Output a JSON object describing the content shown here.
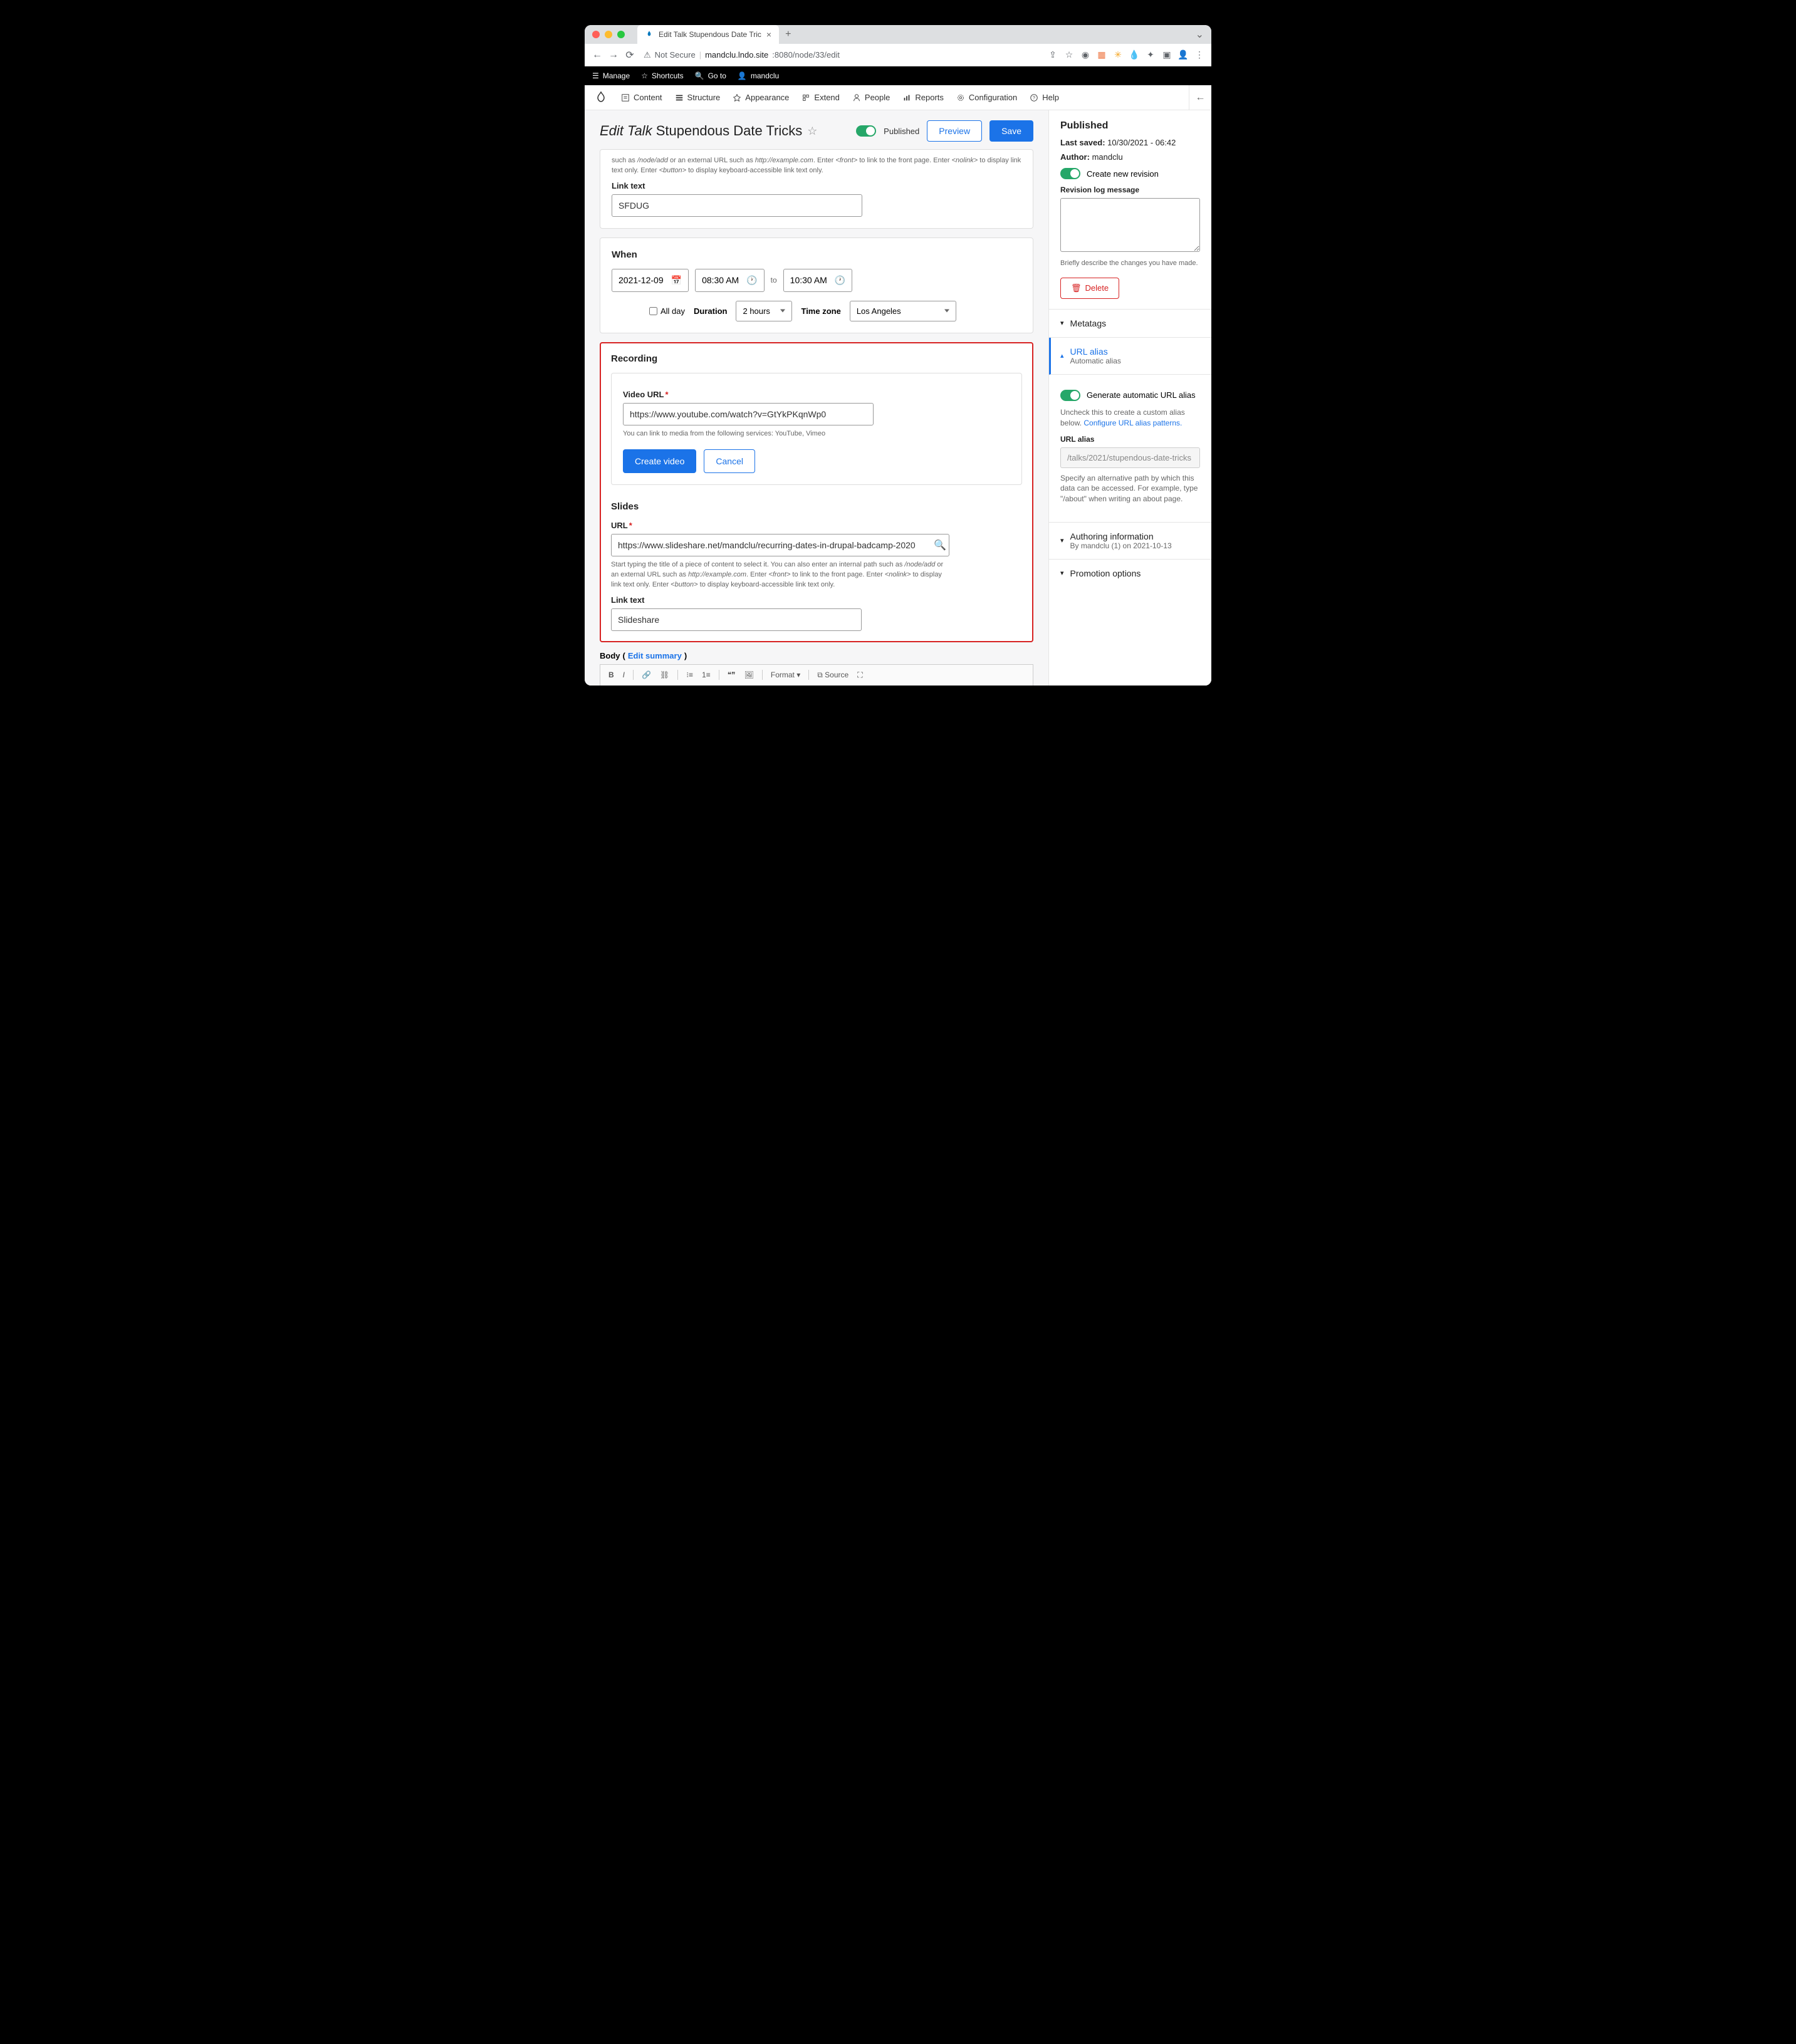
{
  "browser": {
    "tab_title": "Edit Talk Stupendous Date Tric",
    "url_not_secure": "Not Secure",
    "url_host": "mandclu.lndo.site",
    "url_path": ":8080/node/33/edit"
  },
  "adminbar": {
    "manage": "Manage",
    "shortcuts": "Shortcuts",
    "goto": "Go to",
    "user": "mandclu"
  },
  "toolbar": {
    "content": "Content",
    "structure": "Structure",
    "appearance": "Appearance",
    "extend": "Extend",
    "people": "People",
    "reports": "Reports",
    "configuration": "Configuration",
    "help": "Help"
  },
  "page": {
    "title_prefix": "Edit Talk",
    "title": "Stupendous Date Tricks",
    "published_label": "Published",
    "preview": "Preview",
    "save": "Save"
  },
  "url_help": "such as /node/add or an external URL such as http://example.com. Enter <front> to link to the front page. Enter <nolink> to display link text only. Enter <button> to display keyboard-accessible link text only.",
  "linktext_label": "Link text",
  "linktext_value": "SFDUG",
  "when": {
    "title": "When",
    "date": "2021-12-09",
    "start": "08:30 AM",
    "end": "10:30 AM",
    "to": "to",
    "allday": "All day",
    "duration_label": "Duration",
    "duration_value": "2 hours",
    "tz_label": "Time zone",
    "tz_value": "Los Angeles"
  },
  "recording": {
    "title": "Recording",
    "video_label": "Video URL",
    "video_value": "https://www.youtube.com/watch?v=GtYkPKqnWp0",
    "video_help": "You can link to media from the following services: YouTube, Vimeo",
    "create_btn": "Create video",
    "cancel_btn": "Cancel"
  },
  "slides": {
    "title": "Slides",
    "url_label": "URL",
    "url_value": "https://www.slideshare.net/mandclu/recurring-dates-in-drupal-badcamp-2020",
    "help": "Start typing the title of a piece of content to select it. You can also enter an internal path such as /node/add or an external URL such as http://example.com. Enter <front> to link to the front page. Enter <nolink> to display link text only. Enter <button> to display keyboard-accessible link text only.",
    "linktext_label": "Link text",
    "linktext_value": "Slideshare"
  },
  "body": {
    "label": "Body",
    "edit_summary": "Edit summary",
    "format": "Format",
    "source": "Source"
  },
  "side": {
    "published": "Published",
    "last_saved_label": "Last saved:",
    "last_saved_value": "10/30/2021 - 06:42",
    "author_label": "Author:",
    "author_value": "mandclu",
    "revision": "Create new revision",
    "revlog_label": "Revision log message",
    "revlog_help": "Briefly describe the changes you have made.",
    "delete": "Delete",
    "metatags": "Metatags",
    "url_alias": "URL alias",
    "url_alias_sub": "Automatic alias",
    "gen_auto": "Generate automatic URL alias",
    "gen_auto_desc": "Uncheck this to create a custom alias below.",
    "configure_link": "Configure URL alias patterns.",
    "alias_label": "URL alias",
    "alias_value": "/talks/2021/stupendous-date-tricks",
    "alias_help": "Specify an alternative path by which this data can be accessed. For example, type \"/about\" when writing an about page.",
    "authoring": "Authoring information",
    "authoring_sub": "By mandclu (1) on 2021-10-13",
    "promotion": "Promotion options"
  }
}
